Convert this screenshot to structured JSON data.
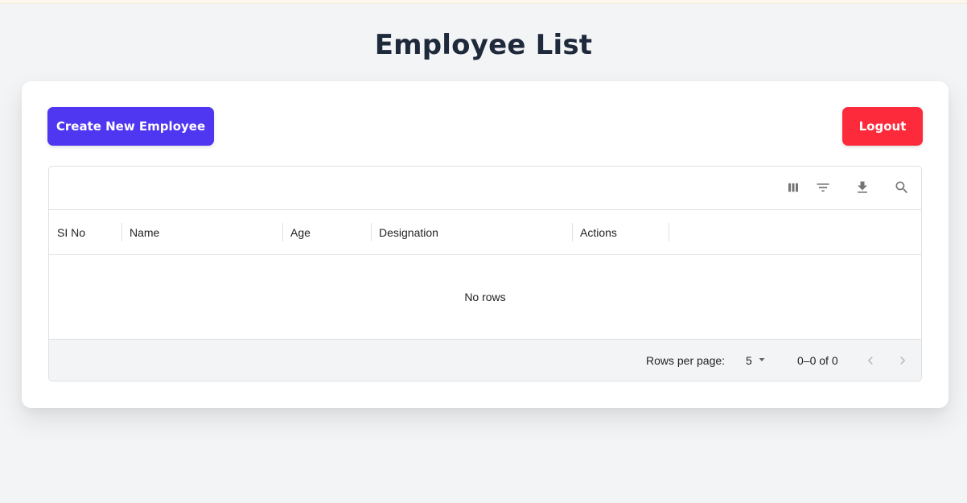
{
  "page": {
    "title": "Employee List"
  },
  "actions": {
    "create_label": "Create New Employee",
    "logout_label": "Logout"
  },
  "toolbar": {
    "icons": [
      "columns-icon",
      "filter-icon",
      "download-icon",
      "search-icon"
    ]
  },
  "table": {
    "columns": [
      {
        "label": "SI No"
      },
      {
        "label": "Name"
      },
      {
        "label": "Age"
      },
      {
        "label": "Designation"
      },
      {
        "label": "Actions"
      }
    ],
    "empty_text": "No rows"
  },
  "pagination": {
    "rows_per_page_label": "Rows per page:",
    "rows_per_page_value": "5",
    "range_text": "0–0 of 0"
  },
  "colors": {
    "create_button": "#4f36f0",
    "logout_button": "#fc2a3b",
    "title": "#1e293b",
    "page_background": "#f3f4f6"
  }
}
